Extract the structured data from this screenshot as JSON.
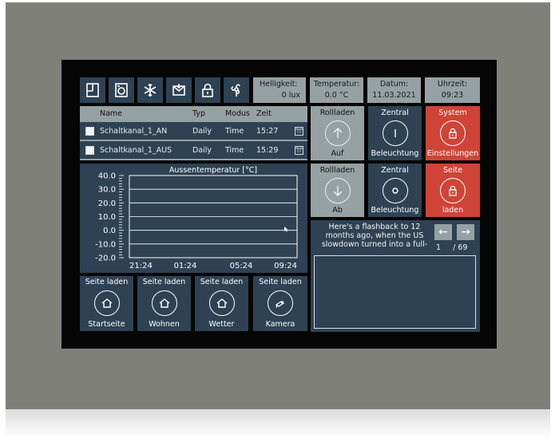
{
  "toolbar_icons": [
    "floorplan-icon",
    "washer-icon",
    "snowflake-icon",
    "mail-icon",
    "lock-icon",
    "fan-icon"
  ],
  "info": {
    "helligkeit": {
      "label": "Helligkeit:",
      "value": "0 lux"
    },
    "temperatur": {
      "label": "Temperatur:",
      "value": "0.0 °C"
    },
    "datum": {
      "label": "Datum:",
      "value": "11.03.2021"
    },
    "uhrzeit": {
      "label": "Uhrzeit:",
      "value": "09:23"
    }
  },
  "schedule": {
    "headers": {
      "name": "Name",
      "typ": "Typ",
      "modus": "Modus",
      "zeit": "Zeit"
    },
    "rows": [
      {
        "name": "Schaltkanal_1_AN",
        "typ": "Daily",
        "modus": "Time",
        "zeit": "15:27"
      },
      {
        "name": "Schaltkanal_1_AUS",
        "typ": "Daily",
        "modus": "Time",
        "zeit": "15:29"
      }
    ]
  },
  "chart_data": {
    "type": "line",
    "title": "Aussentemperatur [°C]",
    "x": [
      "21:24",
      "01:24",
      "05:24",
      "09:24"
    ],
    "series": [
      {
        "values": []
      }
    ],
    "ylim": [
      -20,
      40
    ],
    "y_ticks": [
      "40.0",
      "30.0",
      "20.0",
      "10.0",
      "0.0",
      "-10.0",
      "-20.0"
    ],
    "grid": true
  },
  "tiles": {
    "rollladen_auf": {
      "top": "Rollladen",
      "bottom": "Auf"
    },
    "zentral_1": {
      "top": "Zentral",
      "bottom": "Beleuchtung"
    },
    "system": {
      "top": "System",
      "bottom": "Einstellungen"
    },
    "rollladen_ab": {
      "top": "Rollladen",
      "bottom": "Ab"
    },
    "zentral_2": {
      "top": "Zentral",
      "bottom": "Beleuchtung"
    },
    "seite": {
      "top": "Seite",
      "bottom": "laden"
    }
  },
  "message": {
    "text": "Here's a flashback to 12 months ago, when the US slowdown turned into a full-",
    "page_current": "1",
    "page_total": "/ 69"
  },
  "nav": [
    {
      "top": "Seite laden",
      "bottom": "Startseite",
      "icon": "home-icon"
    },
    {
      "top": "Seite laden",
      "bottom": "Wohnen",
      "icon": "home-icon"
    },
    {
      "top": "Seite laden",
      "bottom": "Wetter",
      "icon": "home-icon"
    },
    {
      "top": "Seite laden",
      "bottom": "Kamera",
      "icon": "camera-icon"
    }
  ],
  "colors": {
    "panel": "#2e4254",
    "light": "#96a1a3",
    "accent": "#cf4436",
    "bezel": "#7f807a"
  }
}
